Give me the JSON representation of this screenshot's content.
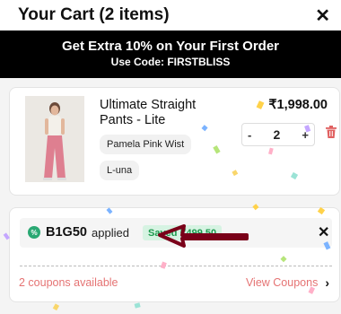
{
  "header": {
    "title": "Your Cart (2 items)",
    "close_icon": "close-icon"
  },
  "promo": {
    "headline": "Get Extra 10% on Your First Order",
    "code_line": "Use Code: FIRSTBLISS"
  },
  "cart_item": {
    "name": "Ultimate Straight Pants - Lite",
    "price": "₹1,998.00",
    "color": "Pamela Pink Wist",
    "size": "L-una",
    "quantity": "2",
    "minus_label": "-",
    "plus_label": "+",
    "remove_icon": "trash-icon"
  },
  "coupon": {
    "code": "B1G50",
    "status": "applied",
    "savings": "Saved ₹499.50",
    "available_text": "2 coupons available",
    "view_label": "View Coupons",
    "remove_icon": "close-icon"
  },
  "colors": {
    "promo_bg": "#000000",
    "accent_red": "#e57373",
    "green": "#1c9a4d",
    "arrow": "#7a0019"
  }
}
